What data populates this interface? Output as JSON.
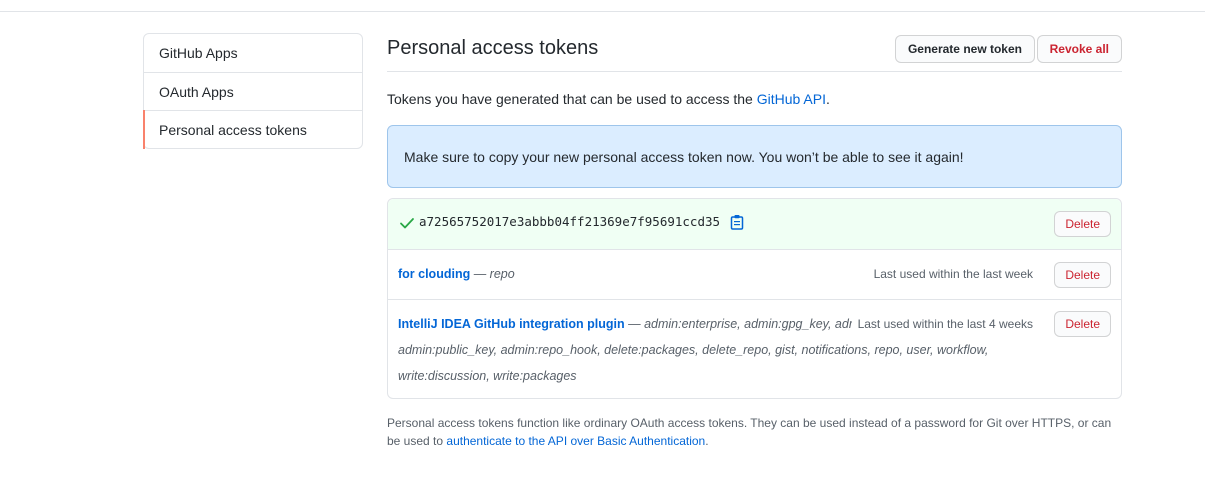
{
  "sidebar": {
    "items": [
      {
        "label": "GitHub Apps"
      },
      {
        "label": "OAuth Apps"
      },
      {
        "label": "Personal access tokens"
      }
    ]
  },
  "header": {
    "title": "Personal access tokens",
    "generate_label": "Generate new token",
    "revoke_label": "Revoke all"
  },
  "intro": {
    "text": "Tokens you have generated that can be used to access the ",
    "link": "GitHub API",
    "end": "."
  },
  "flash": {
    "text": "Make sure to copy your new personal access token now. You won’t be able to see it again!"
  },
  "tokens": {
    "new_token": {
      "value": "a72565752017e3abbb04ff21369e7f95691ccd35",
      "delete_label": "Delete"
    },
    "items": [
      {
        "name": "for clouding",
        "separator": " — ",
        "scopes": "repo",
        "last_used": "Last used within the last week",
        "delete_label": "Delete"
      },
      {
        "name": "IntelliJ IDEA GitHub integration plugin",
        "separator": " — ",
        "scopes": "admin:enterprise, admin:gpg_key, admin:org, admin:org_hook, admin:public_key, admin:repo_hook, delete:packages, delete_repo, gist, notifications, repo, user, workflow, write:discussion, write:packages",
        "last_used": "Last used within the last 4 weeks",
        "delete_label": "Delete"
      }
    ]
  },
  "footnote": {
    "text": "Personal access tokens function like ordinary OAuth access tokens. They can be used instead of a password for Git over HTTPS, or can be used to ",
    "link": "authenticate to the API over Basic Authentication",
    "end": "."
  },
  "colors": {
    "link": "#0366d6",
    "danger": "#cb2431",
    "success_bg": "#f0fff4",
    "flash_bg": "#dbedff",
    "selected_accent": "#f9826c"
  }
}
